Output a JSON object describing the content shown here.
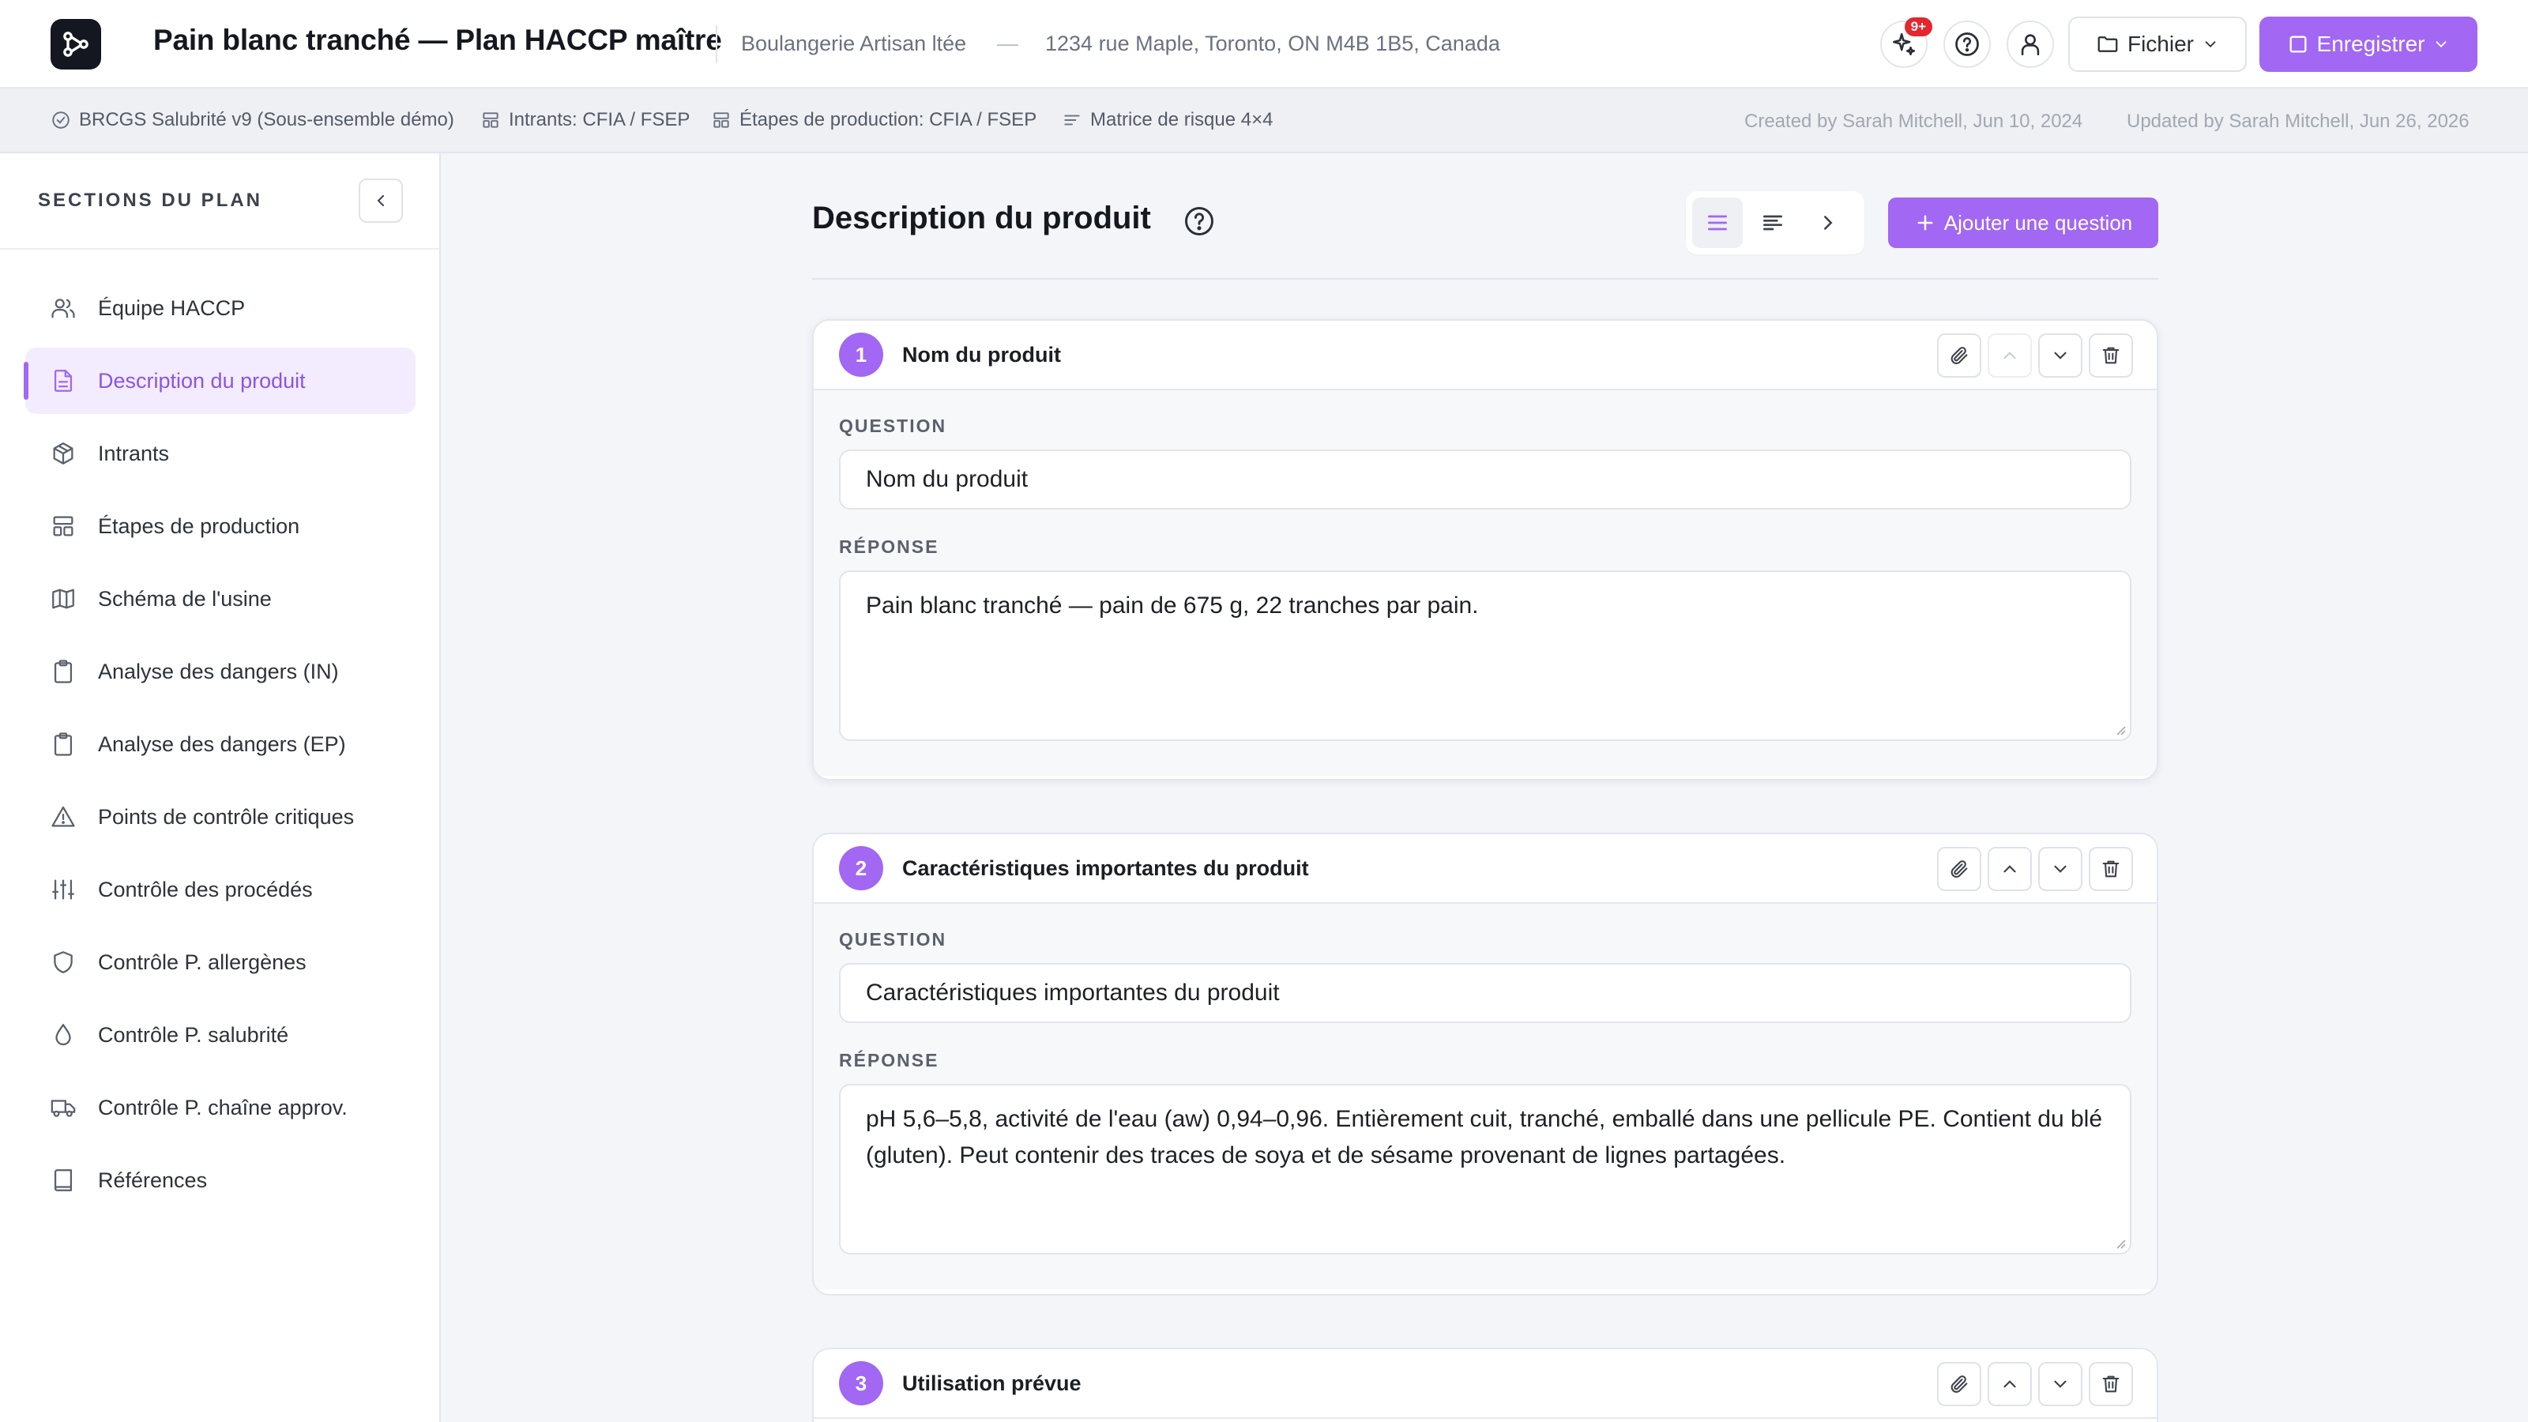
{
  "header": {
    "title": "Pain blanc tranché — Plan HACCP maître",
    "organization": "Boulangerie Artisan ltée",
    "separator": "—",
    "address": "1234 rue Maple, Toronto, ON M4B 1B5, Canada",
    "notification_badge": "9+",
    "file_button": "Fichier",
    "save_button": "Enregistrer"
  },
  "subbar": {
    "standard": "BRCGS Salubrité v9 (Sous-ensemble démo)",
    "inputs": "Intrants: CFIA / FSEP",
    "steps": "Étapes de production: CFIA / FSEP",
    "matrix": "Matrice de risque 4×4",
    "created": "Created by Sarah Mitchell, Jun 10, 2024",
    "updated": "Updated by Sarah Mitchell, Jun 26, 2026"
  },
  "sidebar": {
    "heading": "SECTIONS DU PLAN",
    "items": [
      {
        "label": "Équipe HACCP",
        "icon": "users-icon"
      },
      {
        "label": "Description du produit",
        "icon": "document-icon",
        "active": true
      },
      {
        "label": "Intrants",
        "icon": "box-icon"
      },
      {
        "label": "Étapes de production",
        "icon": "layout-icon"
      },
      {
        "label": "Schéma de l'usine",
        "icon": "map-icon"
      },
      {
        "label": "Analyse des dangers (IN)",
        "icon": "clipboard-icon"
      },
      {
        "label": "Analyse des dangers (EP)",
        "icon": "clipboard-icon"
      },
      {
        "label": "Points de contrôle critiques",
        "icon": "warning-icon"
      },
      {
        "label": "Contrôle des procédés",
        "icon": "sliders-icon"
      },
      {
        "label": "Contrôle P. allergènes",
        "icon": "shield-icon"
      },
      {
        "label": "Contrôle P. salubrité",
        "icon": "droplet-icon"
      },
      {
        "label": "Contrôle P. chaîne approv.",
        "icon": "truck-icon"
      },
      {
        "label": "Références",
        "icon": "book-icon"
      }
    ]
  },
  "main": {
    "section_title": "Description du produit",
    "add_question": "Ajouter une question",
    "questions": [
      {
        "number": "1",
        "title": "Nom du produit",
        "question_label": "QUESTION",
        "question": "Nom du produit",
        "answer_label": "RÉPONSE",
        "answer": "Pain blanc tranché — pain de 675 g, 22 tranches par pain."
      },
      {
        "number": "2",
        "title": "Caractéristiques importantes du produit",
        "question_label": "QUESTION",
        "question": "Caractéristiques importantes du produit",
        "answer_label": "RÉPONSE",
        "answer": "pH 5,6–5,8, activité de l'eau (aw) 0,94–0,96. Entièrement cuit, tranché, emballé dans une pellicule PE. Contient du blé (gluten). Peut contenir des traces de soya et de sésame provenant de lignes partagées."
      },
      {
        "number": "3",
        "title": "Utilisation prévue"
      }
    ]
  },
  "colors": {
    "accent": "#a267f3",
    "active_bg": "#f3ecfe",
    "badge": "#e5262d"
  }
}
